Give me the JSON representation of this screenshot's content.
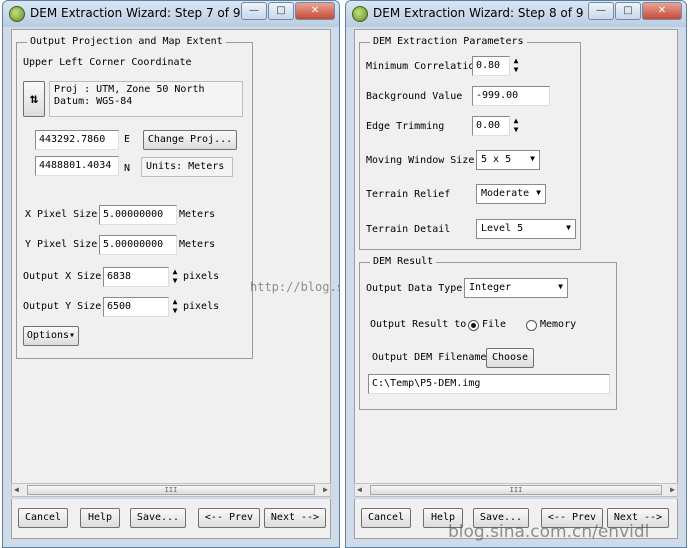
{
  "step7": {
    "title": "DEM Extraction Wizard: Step 7 of 9",
    "controls": {
      "minimize": "—",
      "maximize": "□",
      "close": "✕"
    },
    "group_title": "Output Projection and Map Extent",
    "coord_title": "Upper Left Corner Coordinate",
    "toggle_symbol": "⇅",
    "proj_line": "Proj : UTM, Zone 50 North",
    "datum_line": "Datum: WGS-84",
    "easting": "443292.7860",
    "easting_label": "E",
    "northing": "4488801.4034",
    "northing_label": "N",
    "change_proj": "Change Proj...",
    "units": "Units: Meters",
    "x_pixel_label": "X Pixel Size",
    "x_pixel": "5.00000000",
    "x_pixel_unit": "Meters",
    "y_pixel_label": "Y Pixel Size",
    "y_pixel": "5.00000000",
    "y_pixel_unit": "Meters",
    "out_x_label": "Output X Size",
    "out_x": "6838",
    "out_x_unit": "pixels",
    "out_y_label": "Output Y Size",
    "out_y": "6500",
    "out_y_unit": "pixels",
    "options": "Options▾"
  },
  "step8": {
    "title": "DEM Extraction Wizard: Step 8 of 9",
    "controls": {
      "minimize": "—",
      "maximize": "□",
      "close": "✕"
    },
    "params_title": "DEM Extraction Parameters",
    "min_corr_label": "Minimum Correlatio",
    "min_corr": "0.80",
    "bg_label": "Background Value",
    "bg": "-999.00",
    "edge_label": "Edge Trimming",
    "edge": "0.00",
    "window_label": "Moving Window Size",
    "window": "5 x 5",
    "relief_label": "Terrain Relief",
    "relief": "Moderate",
    "detail_label": "Terrain Detail",
    "detail": "Level 5",
    "result_title": "DEM Result",
    "dtype_label": "Output Data Type",
    "dtype": "Integer",
    "result_to_label": "Output Result to",
    "file_label": "File",
    "memory_label": "Memory",
    "result_to_selected": "File",
    "filename_label": "Output DEM Filename",
    "choose": "Choose",
    "filename": "C:\\Temp\\P5-DEM.img"
  },
  "spinner": {
    "up": "▲",
    "down": "▼"
  },
  "dropdown_arrow": "▼",
  "scroll": {
    "left": "◀",
    "right": "▶",
    "grip": "III"
  },
  "footer": {
    "cancel": "Cancel",
    "help": "Help",
    "save": "Save...",
    "prev": "<-- Prev",
    "next": "Next -->"
  },
  "watermark": {
    "url": "http://blog.sina.com.cn/",
    "blog": "blog.sina.com.cn/envidl"
  },
  "colors": {
    "window_frame": "#cfdbe8",
    "client": "#f0f0f0",
    "close_button": "#c54a35"
  }
}
